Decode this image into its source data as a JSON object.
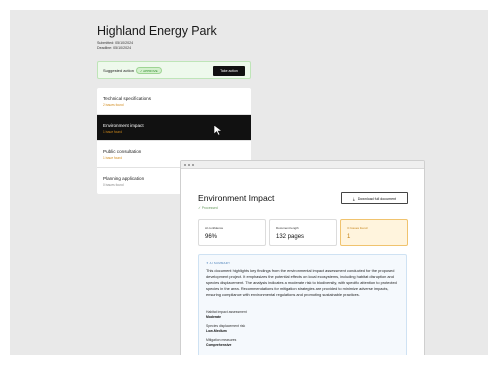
{
  "project": {
    "title": "Highland Energy Park",
    "submitted": "Submitted: 05/10/2024",
    "deadline": "Deadline: 05/10/2024"
  },
  "suggested": {
    "label": "Suggested action",
    "badge": "✓ APPROVE",
    "button": "Take action"
  },
  "sections": [
    {
      "title": "Technical specifications",
      "sub": "2 issues found"
    },
    {
      "title": "Environment impact",
      "sub": "1 issue found"
    },
    {
      "title": "Public consultation",
      "sub": "1 issue found"
    },
    {
      "title": "Planning application",
      "sub": "0 issues found"
    }
  ],
  "document": {
    "title": "Environment Impact",
    "status": "✓ Processed",
    "download": "Download full document",
    "stats": [
      {
        "label": "AI confidence",
        "value": "96%"
      },
      {
        "label": "Document length",
        "value": "132 pages"
      },
      {
        "label": "⊙ Issues found",
        "value": "1"
      }
    ],
    "summary": {
      "tag": "✦ AI SUMMARY",
      "body": "This document highlights key findings from the environmental impact assessment conducted for the proposed development project. It emphasizes the potential effects on local ecosystems, including habitat disruption and species displacement. The analysis indicates a moderate risk to biodiversity, with specific attention to protected species in the area. Recommendations for mitigation strategies are provided to minimize adverse impacts, ensuring compliance with environmental regulations and promoting sustainable practices.",
      "items": [
        {
          "k": "Habitat impact assessment",
          "v": "Moderate"
        },
        {
          "k": "Species displacement risk",
          "v": "Low-Medium"
        },
        {
          "k": "Mitigation measures",
          "v": "Comprehensive"
        }
      ]
    }
  },
  "colors": {
    "accent_dark": "#111111",
    "approve_green": "#2f8a2a",
    "issue_orange": "#d18b1c",
    "summary_blue": "#3f78b5"
  }
}
